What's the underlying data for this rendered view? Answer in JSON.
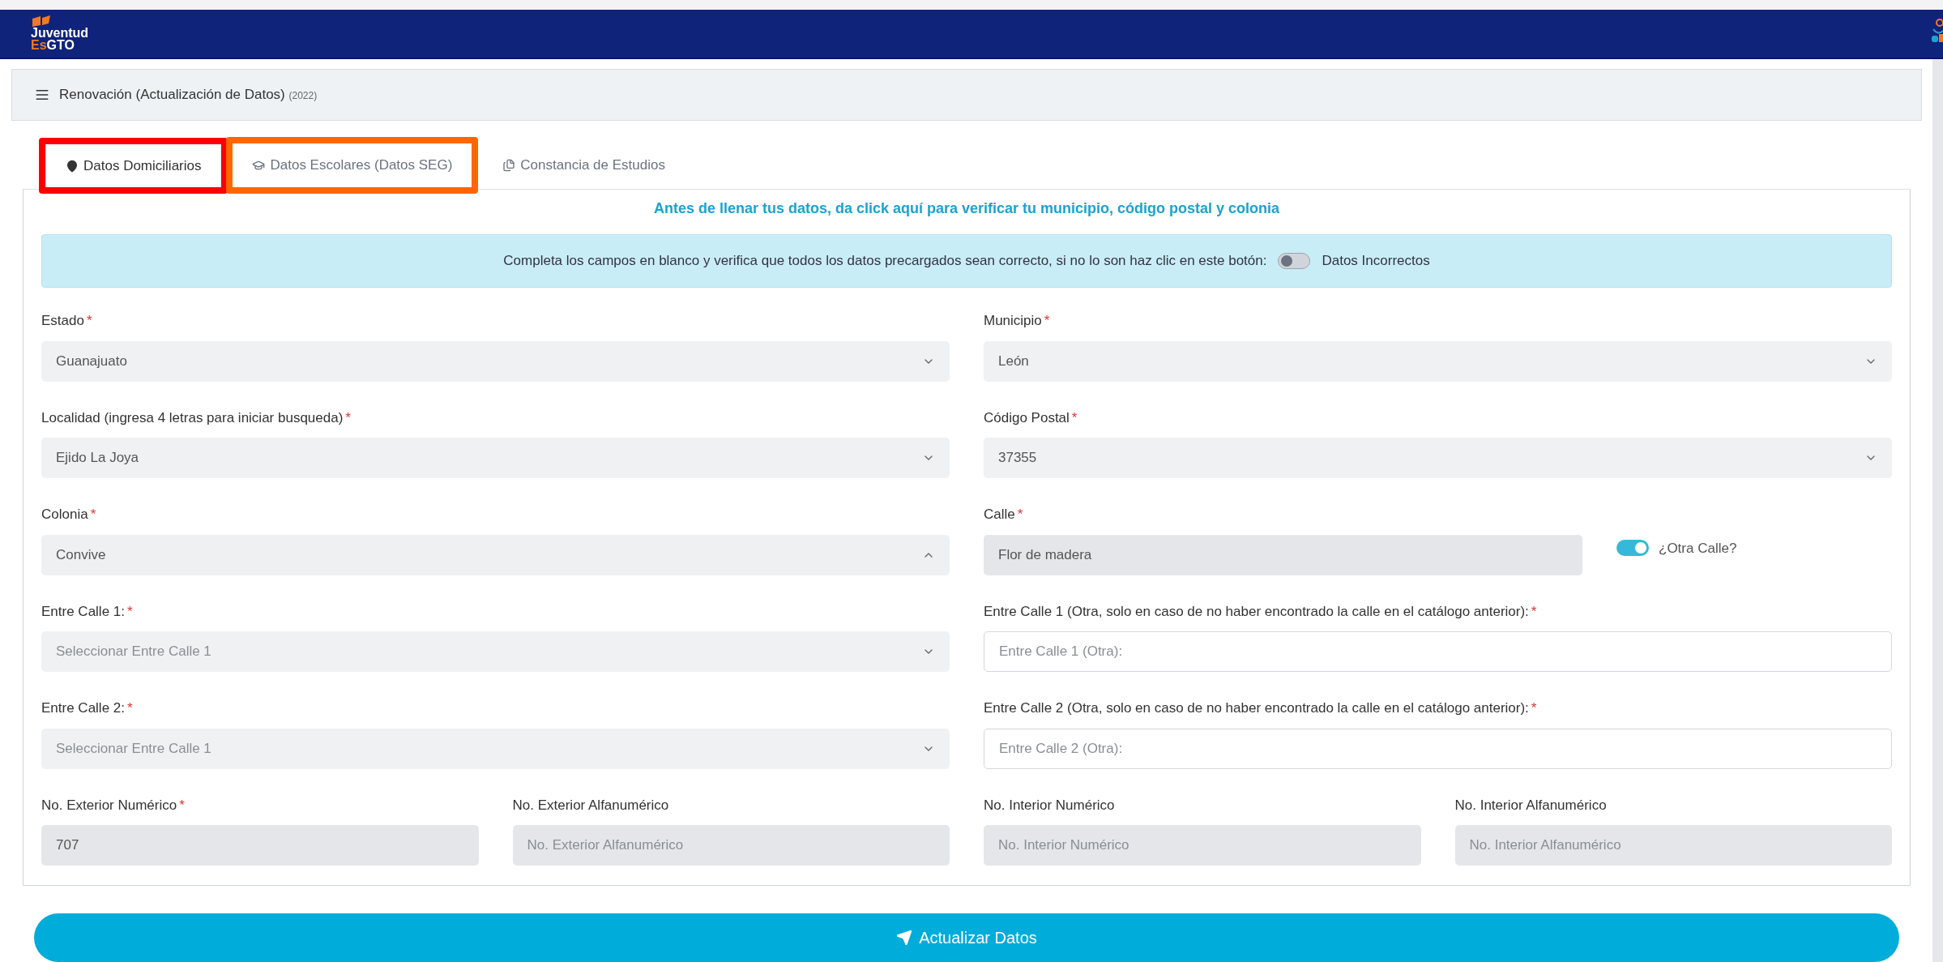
{
  "navbar": {
    "logo_top": "Juventud",
    "logo_es": "Es",
    "logo_gto": "GTO"
  },
  "header": {
    "title": "Renovación (Actualización de Datos)",
    "year": "(2022)"
  },
  "tabs": [
    {
      "label": "Datos Domiciliarios",
      "selected": true,
      "color": "#ff0000"
    },
    {
      "label": "Datos Escolares (Datos SEG)",
      "selected": false,
      "color": "#ff6600"
    },
    {
      "label": "Constancia de Estudios",
      "selected": false
    }
  ],
  "verify_link": "Antes de llenar tus datos, da click aquí para verificar tu municipio, código postal y colonia",
  "alert": {
    "text": "Completa los campos en blanco y verifica que todos los datos precargados sean correcto, si no lo son haz clic en este botón:",
    "toggle_label": "Datos Incorrectos",
    "on": false
  },
  "rows": [
    {
      "fields": [
        {
          "kind": "select",
          "label": "Estado",
          "required_mark": "*",
          "value": "Guanajuato",
          "expanded": false
        },
        {
          "kind": "select",
          "label": "Municipio",
          "required_mark": "*",
          "value": "León",
          "expanded": false
        }
      ]
    },
    {
      "fields": [
        {
          "kind": "select",
          "label": "Localidad (ingresa 4 letras para iniciar busqueda)",
          "required_mark": "*",
          "value": "Ejido La Joya",
          "expanded": false
        },
        {
          "kind": "select",
          "label": "Código Postal",
          "required_mark": "*",
          "value": "37355",
          "expanded": false
        }
      ]
    },
    {
      "fields": [
        {
          "kind": "select",
          "label": "Colonia",
          "required_mark": "*",
          "value": "Convive",
          "expanded": true
        },
        {
          "kind": "locked",
          "label": "Calle",
          "required_mark": "*",
          "value": "Flor de madera",
          "toggle": {
            "label": "¿Otra Calle?",
            "on": true
          }
        }
      ]
    },
    {
      "fields": [
        {
          "kind": "select",
          "label": "Entre Calle 1:",
          "required_mark": "*",
          "placeholder": "Seleccionar Entre Calle 1",
          "expanded": false
        },
        {
          "kind": "text",
          "label": "Entre Calle 1 (Otra, solo en caso de no haber encontrado la calle en el catálogo anterior):",
          "required_mark": "*",
          "placeholder": "Entre Calle 1 (Otra):"
        }
      ]
    },
    {
      "fields": [
        {
          "kind": "select",
          "label": "Entre Calle 2:",
          "required_mark": "*",
          "placeholder": "Seleccionar Entre Calle 1",
          "expanded": false
        },
        {
          "kind": "text",
          "label": "Entre Calle 2 (Otra, solo en caso de no haber encontrado la calle en el catálogo anterior):",
          "required_mark": "*",
          "placeholder": "Entre Calle 2 (Otra):"
        }
      ]
    },
    {
      "fields": [
        {
          "kind": "locked",
          "label": "No. Exterior Numérico",
          "required_mark": "*",
          "value": "707"
        },
        {
          "kind": "locked",
          "label": "No. Exterior Alfanumérico",
          "placeholder": "No. Exterior Alfanumérico"
        },
        {
          "kind": "locked",
          "label": "No. Interior Numérico",
          "placeholder": "No. Interior Numérico"
        },
        {
          "kind": "locked",
          "label": "No. Interior Alfanumérico",
          "placeholder": "No. Interior Alfanumérico"
        }
      ]
    }
  ],
  "submit": {
    "label": "Actualizar Datos"
  }
}
